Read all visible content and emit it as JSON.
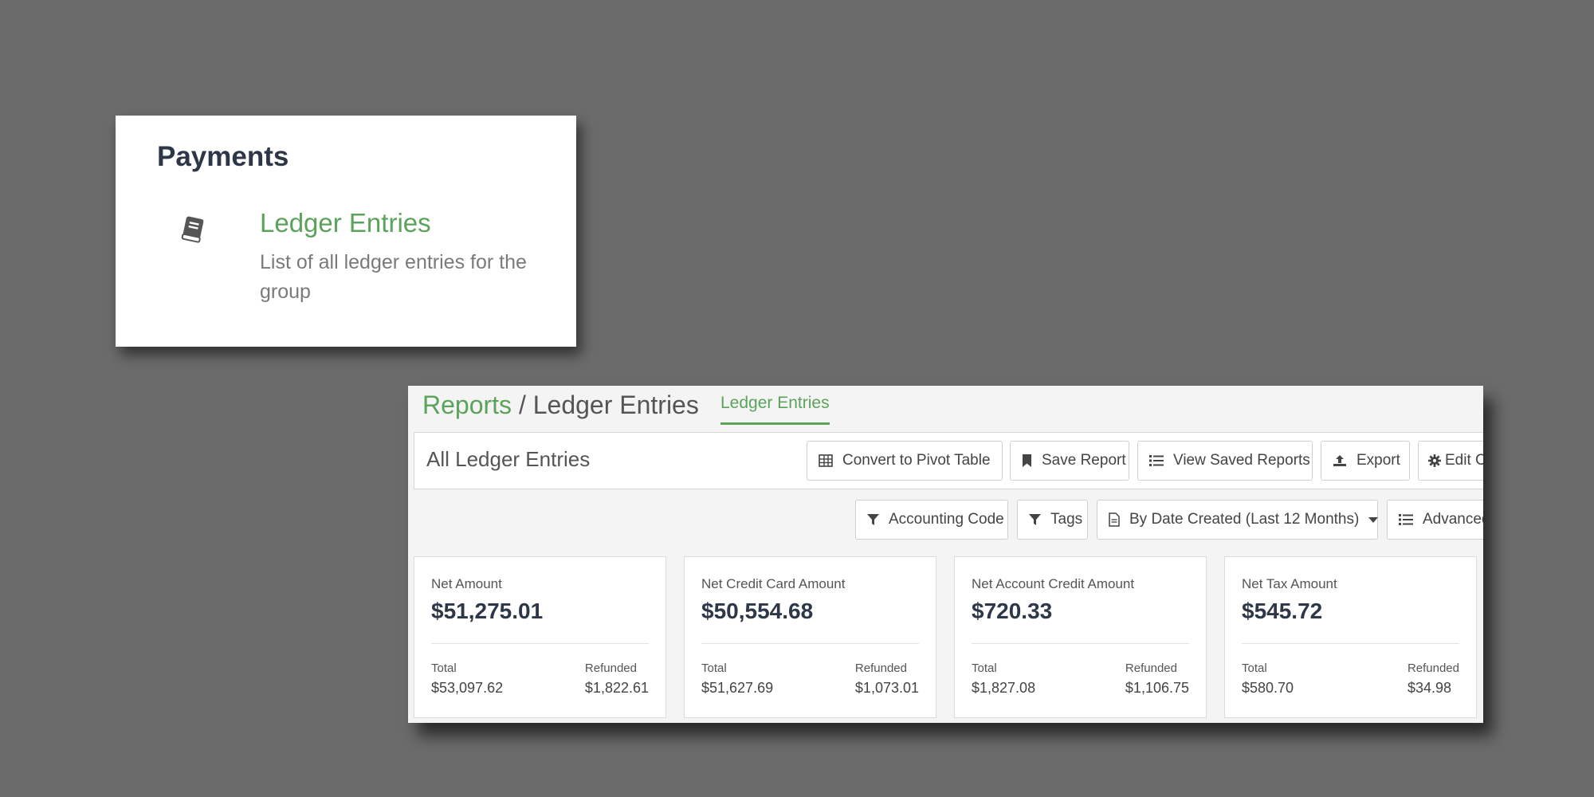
{
  "payments": {
    "title": "Payments",
    "link": {
      "icon": "book-icon",
      "title": "Ledger Entries",
      "description": "List of all ledger entries for the group"
    }
  },
  "reports": {
    "breadcrumb": {
      "root": "Reports",
      "separator": "/",
      "current": "Ledger Entries"
    },
    "tab": "Ledger Entries",
    "toolbar": {
      "title": "All Ledger Entries",
      "buttons": {
        "pivot": "Convert to Pivot Table",
        "save": "Save Report",
        "view_saved": "View Saved Reports",
        "export": "Export",
        "edit_columns": "Edit Columns"
      }
    },
    "filters": {
      "accounting_code": "Accounting Code",
      "tags": "Tags",
      "date_range": "By Date Created (Last 12 Months)",
      "advanced": "Advanced"
    },
    "stats": [
      {
        "label": "Net Amount",
        "value": "$51,275.01",
        "total_label": "Total",
        "total": "$53,097.62",
        "refunded_label": "Refunded",
        "refunded": "$1,822.61"
      },
      {
        "label": "Net Credit Card Amount",
        "value": "$50,554.68",
        "total_label": "Total",
        "total": "$51,627.69",
        "refunded_label": "Refunded",
        "refunded": "$1,073.01"
      },
      {
        "label": "Net Account Credit Amount",
        "value": "$720.33",
        "total_label": "Total",
        "total": "$1,827.08",
        "refunded_label": "Refunded",
        "refunded": "$1,106.75"
      },
      {
        "label": "Net Tax Amount",
        "value": "$545.72",
        "total_label": "Total",
        "total": "$580.70",
        "refunded_label": "Refunded",
        "refunded": "$34.98"
      }
    ]
  },
  "colors": {
    "accent": "#5ba35a",
    "background": "#6b6b6b",
    "heading": "#2d3748"
  }
}
